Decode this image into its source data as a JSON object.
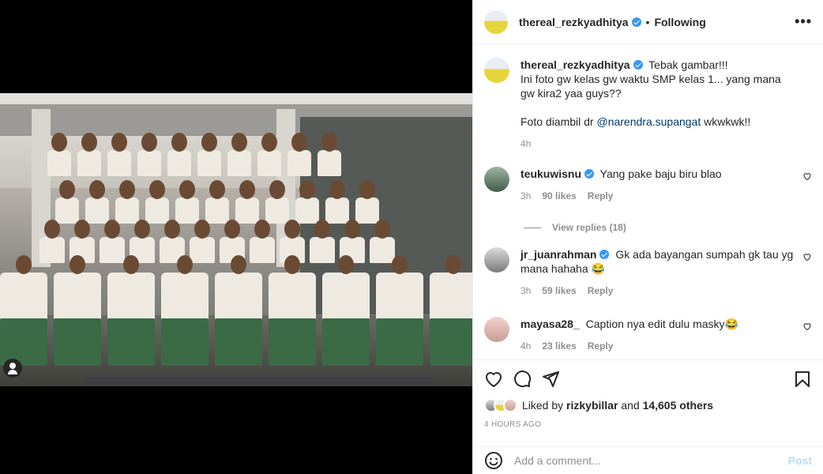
{
  "header": {
    "username": "thereal_rezkyadhitya",
    "follow_status": "Following",
    "separator": "•"
  },
  "caption": {
    "username": "thereal_rezkyadhitya",
    "line1": "Tebak gambar!!!",
    "line2": "Ini foto gw kelas gw waktu SMP kelas 1... yang mana gw kira2 yaa guys??",
    "line3_prefix": "Foto diambil dr",
    "mention": "@narendra.supangat",
    "line3_suffix": "wkwkwk!!",
    "time": "4h"
  },
  "comments": [
    {
      "username": "teukuwisnu",
      "verified": true,
      "text": "Yang pake baju biru blao",
      "time": "3h",
      "likes": "90 likes",
      "reply": "Reply"
    },
    {
      "username": "jr_juanrahman",
      "verified": true,
      "text": "Gk ada bayangan sumpah gk tau yg mana hahaha 😂",
      "time": "3h",
      "likes": "59 likes",
      "reply": "Reply"
    },
    {
      "username": "mayasa28_",
      "verified": false,
      "text": "Caption nya edit dulu masky😂",
      "time": "4h",
      "likes": "23 likes",
      "reply": "Reply"
    }
  ],
  "view_replies": "View replies (18)",
  "likes": {
    "prefix": "Liked by",
    "user": "rizkybillar",
    "middle": "and",
    "others": "14,605 others"
  },
  "timestamp": "4 HOURS AGO",
  "comment_box": {
    "placeholder": "Add a comment...",
    "post_label": "Post"
  },
  "colors": {
    "verified": "#3897f0",
    "link": "#00376b",
    "muted": "#8e8e8e",
    "post_disabled": "#b2dffc"
  }
}
